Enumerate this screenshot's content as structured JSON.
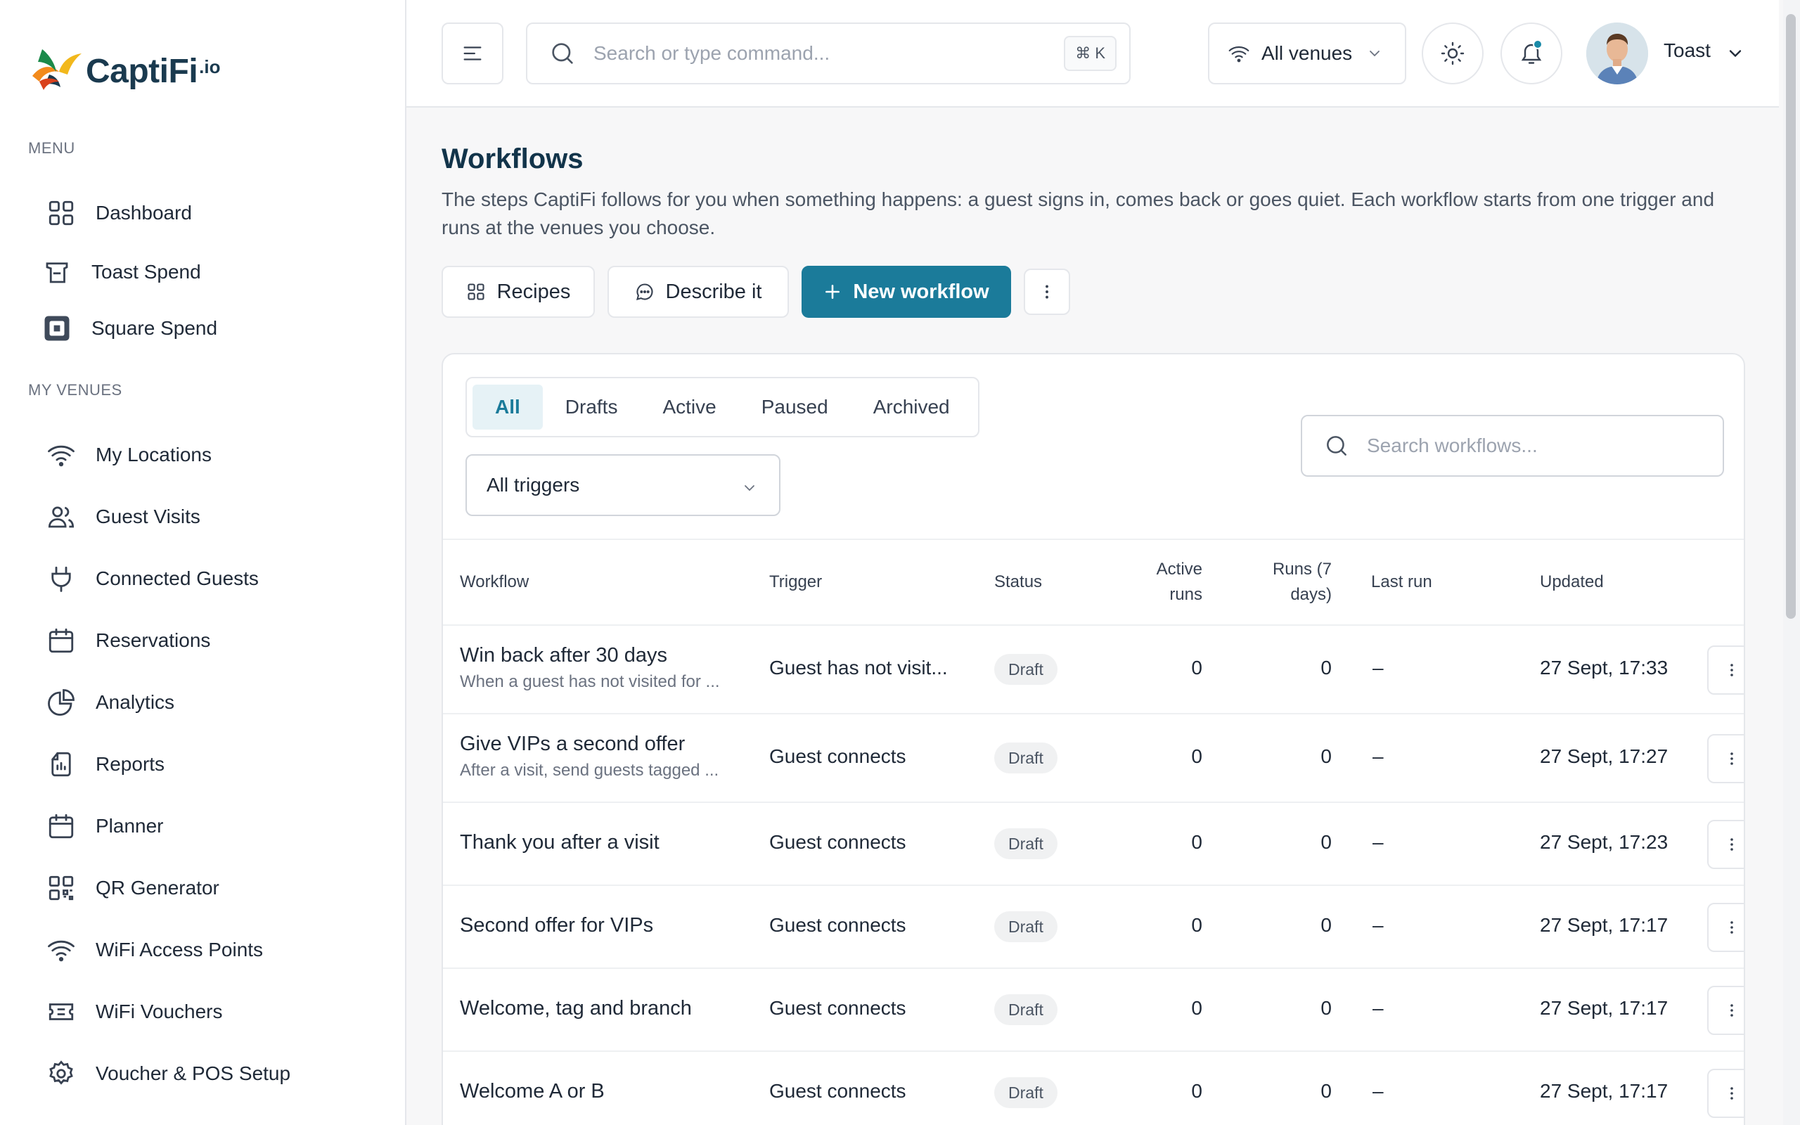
{
  "brand": {
    "name": "CaptiFi",
    "suffix": ".io"
  },
  "sidebar": {
    "menu_label": "MENU",
    "menu_items": [
      {
        "label": "Dashboard",
        "icon": "grid-icon"
      },
      {
        "label": "Toast Spend",
        "icon": "toast-icon"
      },
      {
        "label": "Square Spend",
        "icon": "square-icon"
      }
    ],
    "venues_label": "MY VENUES",
    "venue_items": [
      {
        "label": "My Locations",
        "icon": "wifi-icon"
      },
      {
        "label": "Guest Visits",
        "icon": "users-icon"
      },
      {
        "label": "Connected Guests",
        "icon": "plug-icon"
      },
      {
        "label": "Reservations",
        "icon": "calendar-icon"
      },
      {
        "label": "Analytics",
        "icon": "pie-chart-icon"
      },
      {
        "label": "Reports",
        "icon": "report-icon"
      },
      {
        "label": "Planner",
        "icon": "calendar-icon"
      },
      {
        "label": "QR Generator",
        "icon": "qr-code-icon"
      },
      {
        "label": "WiFi Access Points",
        "icon": "wifi-icon"
      },
      {
        "label": "WiFi Vouchers",
        "icon": "ticket-icon"
      },
      {
        "label": "Voucher & POS Setup",
        "icon": "gear-icon"
      }
    ]
  },
  "topbar": {
    "search_placeholder": "Search or type command...",
    "shortcut": "⌘ K",
    "venue_selector": "All venues",
    "user_name": "Toast"
  },
  "page": {
    "title": "Workflows",
    "description": "The steps CaptiFi follows for you when something happens: a guest signs in, comes back or goes quiet. Each workflow starts from one trigger and runs at the venues you choose.",
    "buttons": {
      "recipes": "Recipes",
      "describe": "Describe it",
      "new_workflow": "New workflow"
    }
  },
  "filters": {
    "tabs": [
      "All",
      "Drafts",
      "Active",
      "Paused",
      "Archived"
    ],
    "active_tab": "All",
    "trigger_filter": "All triggers",
    "search_placeholder": "Search workflows..."
  },
  "table": {
    "columns": {
      "workflow": "Workflow",
      "trigger": "Trigger",
      "status": "Status",
      "active_runs_1": "Active",
      "active_runs_2": "runs",
      "runs_7d_1": "Runs (7",
      "runs_7d_2": "days)",
      "last_run": "Last run",
      "updated": "Updated"
    },
    "rows": [
      {
        "name": "Win back after 30 days",
        "subtitle": "When a guest has not visited for ...",
        "trigger": "Guest has not visit...",
        "status": "Draft",
        "active_runs": "0",
        "runs_7d": "0",
        "last_run": "–",
        "updated": "27 Sept, 17:33"
      },
      {
        "name": "Give VIPs a second offer",
        "subtitle": "After a visit, send guests tagged ...",
        "trigger": "Guest connects",
        "status": "Draft",
        "active_runs": "0",
        "runs_7d": "0",
        "last_run": "–",
        "updated": "27 Sept, 17:27"
      },
      {
        "name": "Thank you after a visit",
        "subtitle": "",
        "trigger": "Guest connects",
        "status": "Draft",
        "active_runs": "0",
        "runs_7d": "0",
        "last_run": "–",
        "updated": "27 Sept, 17:23"
      },
      {
        "name": "Second offer for VIPs",
        "subtitle": "",
        "trigger": "Guest connects",
        "status": "Draft",
        "active_runs": "0",
        "runs_7d": "0",
        "last_run": "–",
        "updated": "27 Sept, 17:17"
      },
      {
        "name": "Welcome, tag and branch",
        "subtitle": "",
        "trigger": "Guest connects",
        "status": "Draft",
        "active_runs": "0",
        "runs_7d": "0",
        "last_run": "–",
        "updated": "27 Sept, 17:17"
      },
      {
        "name": "Welcome A or B",
        "subtitle": "",
        "trigger": "Guest connects",
        "status": "Draft",
        "active_runs": "0",
        "runs_7d": "0",
        "last_run": "–",
        "updated": "27 Sept, 17:17"
      }
    ]
  },
  "colors": {
    "primary": "#1b7b9a",
    "heading": "#12344a"
  }
}
